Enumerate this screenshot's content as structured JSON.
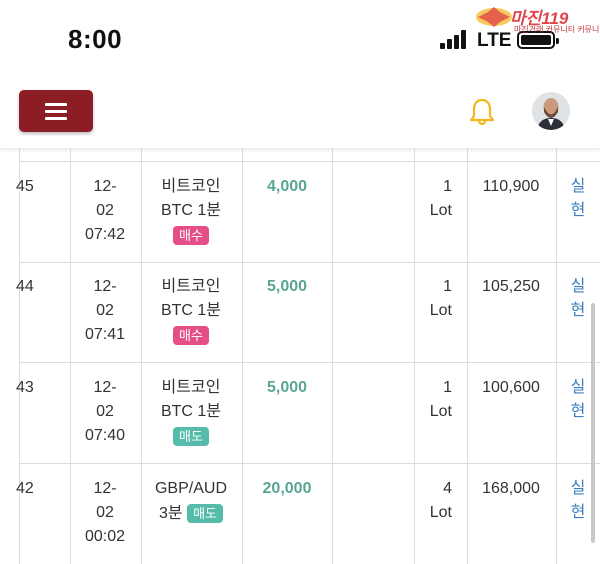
{
  "status_bar": {
    "time": "8:00",
    "network": "LTE"
  },
  "watermark": {
    "title": "마진119",
    "subtitle": "마진거래 커뮤니티 커뮤니티"
  },
  "header": {
    "menu_icon": "hamburger-icon",
    "notification_icon": "bell-icon",
    "avatar_icon": "user-avatar"
  },
  "colors": {
    "menu_button": "#8b1e24",
    "bell": "#f2b81b",
    "amount": "#5aa595",
    "buy_badge": "#e64e88",
    "sell_badge": "#56bbaa",
    "status_link": "#3a7fc1"
  },
  "rows": [
    {
      "no": "45",
      "date1": "12-",
      "date2": "02",
      "time": "07:42",
      "item1": "비트코인",
      "item2": "BTC 1분",
      "side": "매수",
      "amount": "4,000",
      "qty1": "1",
      "qty2": "Lot",
      "price": "110,900",
      "status1": "실",
      "status2": "현"
    },
    {
      "no": "44",
      "date1": "12-",
      "date2": "02",
      "time": "07:41",
      "item1": "비트코인",
      "item2": "BTC 1분",
      "side": "매수",
      "amount": "5,000",
      "qty1": "1",
      "qty2": "Lot",
      "price": "105,250",
      "status1": "실",
      "status2": "현"
    },
    {
      "no": "43",
      "date1": "12-",
      "date2": "02",
      "time": "07:40",
      "item1": "비트코인",
      "item2": "BTC 1분",
      "side": "매도",
      "amount": "5,000",
      "qty1": "1",
      "qty2": "Lot",
      "price": "100,600",
      "status1": "실",
      "status2": "현"
    },
    {
      "no": "42",
      "date1": "12-",
      "date2": "02",
      "time": "00:02",
      "item1": "GBP/AUD",
      "item2": "3분",
      "side": "매도",
      "amount": "20,000",
      "qty1": "4",
      "qty2": "Lot",
      "price": "168,000",
      "status1": "실",
      "status2": "현"
    }
  ]
}
